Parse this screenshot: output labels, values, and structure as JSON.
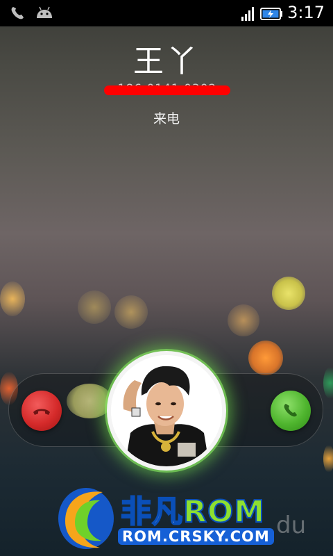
{
  "status_bar": {
    "time": "3:17",
    "icons": [
      "phone-icon",
      "android-icon",
      "signal-icon",
      "battery-charging-icon"
    ]
  },
  "call": {
    "caller_name": "王丫",
    "caller_number": "186 0141 0302",
    "status": "来电"
  },
  "actions": {
    "reject_icon": "hang-up-icon",
    "answer_icon": "answer-call-icon",
    "reject_color": "#d52a2a",
    "answer_color": "#4fb52e"
  },
  "watermark": {
    "brand_cn": "非凡",
    "brand_en": "ROM",
    "url": "ROM.CRSKY.COM",
    "extra": "du"
  }
}
